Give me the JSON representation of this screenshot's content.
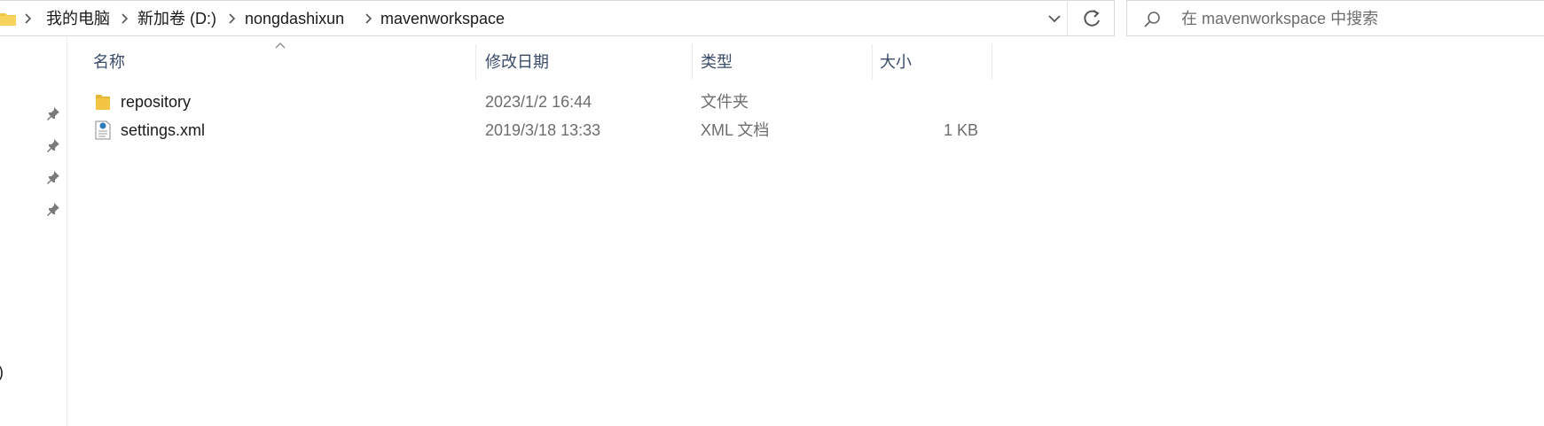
{
  "address_bar": {
    "breadcrumbs": [
      "我的电脑",
      "新加卷 (D:)",
      "nongdashixun",
      "mavenworkspace"
    ]
  },
  "search": {
    "placeholder": "在 mavenworkspace 中搜索"
  },
  "columns": {
    "name": "名称",
    "modified": "修改日期",
    "type": "类型",
    "size": "大小"
  },
  "files": [
    {
      "name": "repository",
      "modified": "2023/1/2 16:44",
      "type": "文件夹",
      "size": "",
      "icon": "folder-icon"
    },
    {
      "name": "settings.xml",
      "modified": "2019/3/18 13:33",
      "type": "XML 文档",
      "size": "1 KB",
      "icon": "xml-file-icon"
    }
  ],
  "nav_fragment": ")",
  "colors": {
    "folder": "#f4c542",
    "header_text": "#3b4c6b",
    "secondary_text": "#6d6d6d"
  }
}
